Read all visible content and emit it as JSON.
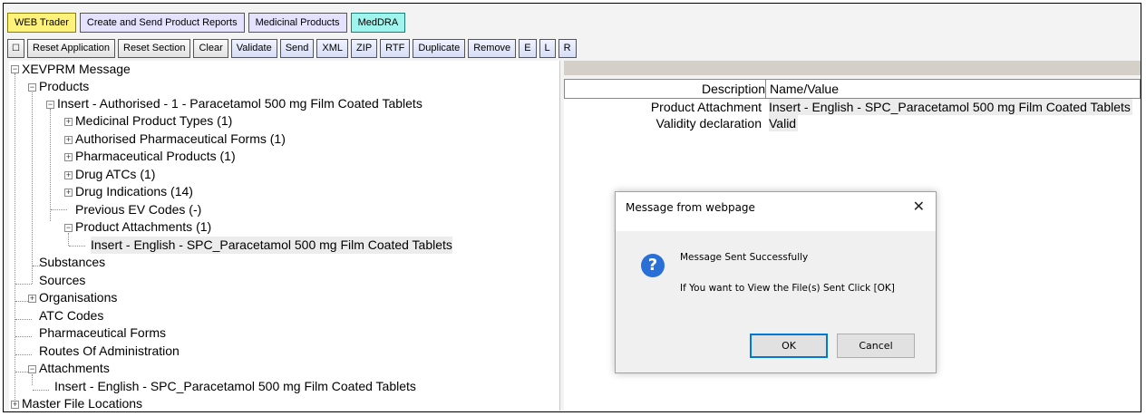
{
  "tabs": [
    "WEB Trader",
    "Create and Send Product Reports",
    "Medicinal Products",
    "MedDRA"
  ],
  "toolbar": {
    "square_icon": "square-icon",
    "buttons": [
      "Reset Application",
      "Reset Section",
      "Clear",
      "Validate",
      "Send",
      "XML",
      "ZIP",
      "RTF",
      "Duplicate",
      "Remove",
      "E",
      "L",
      "R"
    ]
  },
  "tree": {
    "root": "XEVPRM Message",
    "products": "Products",
    "product_item": "Insert - Authorised - 1 - Paracetamol 500 mg Film Coated Tablets",
    "medicinal_product_types": "Medicinal Product Types (1)",
    "authorised_pharmaceutical_forms": "Authorised Pharmaceutical Forms (1)",
    "pharmaceutical_products": "Pharmaceutical Products (1)",
    "drug_atcs": "Drug ATCs (1)",
    "drug_indications": "Drug Indications (14)",
    "previous_ev_codes": "Previous EV Codes (-)",
    "product_attachments": "Product Attachments (1)",
    "product_attachment_item": "Insert - English - SPC_Paracetamol 500 mg Film Coated Tablets",
    "substances": "Substances",
    "sources": "Sources",
    "organisations": "Organisations",
    "atc_codes": "ATC Codes",
    "pharmaceutical_forms": "Pharmaceutical Forms",
    "routes_of_administration": "Routes Of Administration",
    "attachments": "Attachments",
    "attachment_item": "Insert - English - SPC_Paracetamol 500 mg Film Coated Tablets",
    "master_file_locations": "Master File Locations"
  },
  "details": {
    "header_description": "Description",
    "header_value": "Name/Value",
    "rows": [
      {
        "description": "Product Attachment",
        "value": "Insert - English - SPC_Paracetamol 500 mg Film Coated Tablets"
      },
      {
        "description": "Validity declaration",
        "value": "Valid"
      }
    ]
  },
  "dialog": {
    "title": "Message from webpage",
    "close_glyph": "✕",
    "icon_glyph": "?",
    "message_1": "Message Sent Successfully",
    "message_2": "If You want to View the File(s) Sent Click [OK]",
    "ok_label": "OK",
    "cancel_label": "Cancel"
  },
  "icons": {
    "expanded_glyph": "−",
    "collapsed_glyph": "+"
  }
}
